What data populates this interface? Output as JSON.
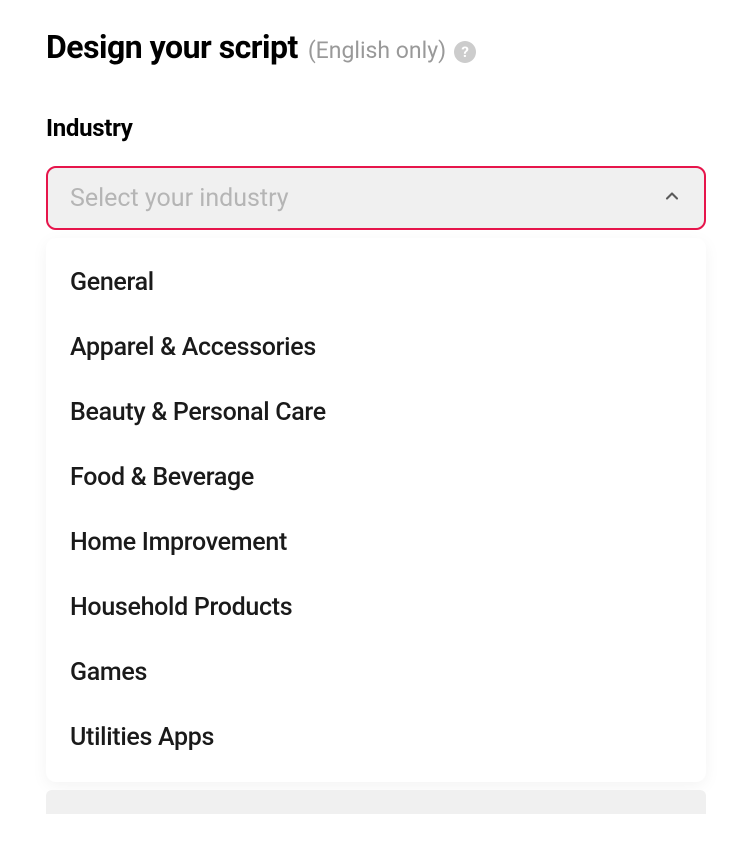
{
  "header": {
    "title": "Design your script",
    "subtitle": "(English only)",
    "help_glyph": "?"
  },
  "industry": {
    "label": "Industry",
    "placeholder": "Select your industry",
    "options": [
      "General",
      "Apparel & Accessories",
      "Beauty & Personal Care",
      "Food & Beverage",
      "Home Improvement",
      "Household Products",
      "Games",
      "Utilities Apps"
    ]
  }
}
